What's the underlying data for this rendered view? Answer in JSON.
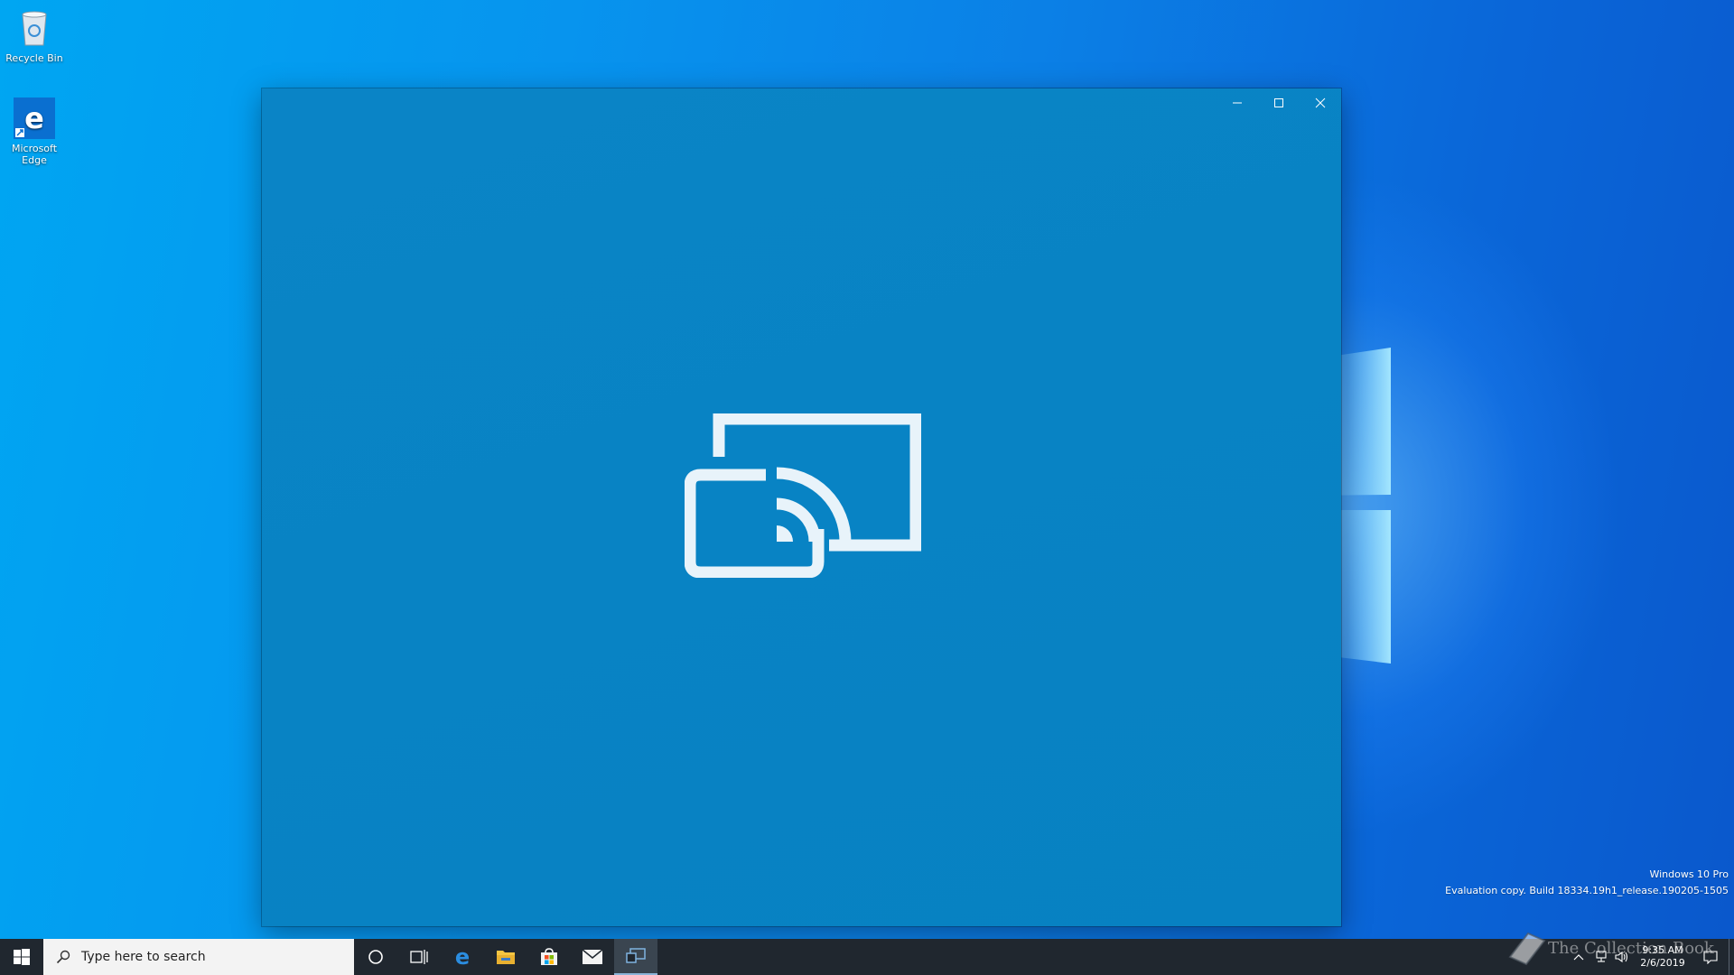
{
  "desktop": {
    "icons": [
      {
        "label": "Recycle Bin",
        "icon": "recycle-bin-icon"
      },
      {
        "label": "Microsoft Edge",
        "icon": "edge-icon"
      }
    ]
  },
  "window": {
    "controls": [
      "minimize-icon",
      "maximize-icon",
      "close-icon"
    ],
    "center_icon": "cast-connect-icon",
    "background": "#0883c4"
  },
  "taskbar": {
    "search_placeholder": "Type here to search",
    "pinned": [
      "cortana-icon",
      "task-view-icon",
      "edge-icon",
      "file-explorer-icon",
      "store-icon",
      "mail-icon",
      "connect-app-icon"
    ],
    "clock_time": "9:35 AM",
    "clock_date": "2/6/2019"
  },
  "watermark": {
    "line1": "Windows 10 Pro",
    "line2": "Evaluation copy. Build 18334.19h1_release.190205-1505"
  },
  "stamp_text": "The Collection Book",
  "colors": {
    "accent": "#0a84c6",
    "taskbar": "#20272f",
    "desktop": "#0794ee"
  }
}
